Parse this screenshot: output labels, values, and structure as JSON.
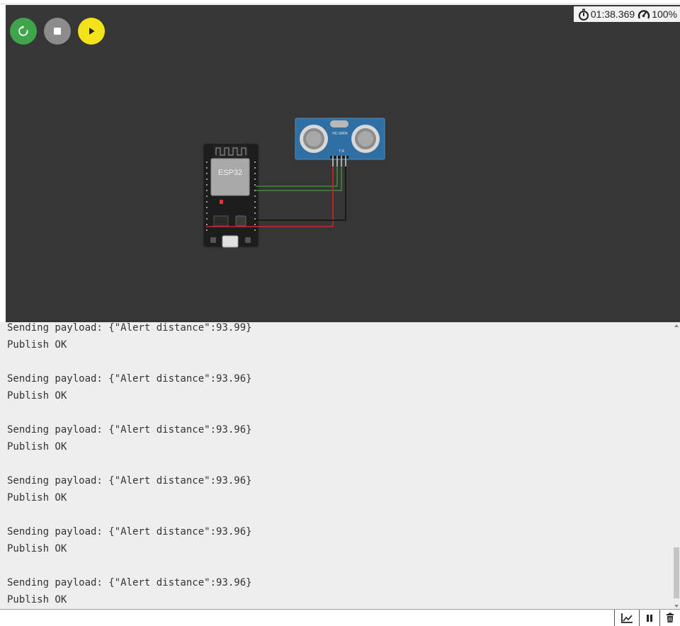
{
  "simulation": {
    "timer": "01:38.369",
    "speed": "100%",
    "controls": {
      "restart_icon": "restart-icon",
      "stop_icon": "stop-icon",
      "play_icon": "play-icon"
    },
    "board": {
      "chip_label": "ESP32"
    },
    "sensor": {
      "model_label": "HC-SR04"
    },
    "wire_colors": {
      "signal": "#3d8b36",
      "power": "#c62828",
      "ground": "#111111"
    }
  },
  "console": {
    "lines": [
      "Sending payload: {\"Alert distance\":93.99}",
      "Publish OK",
      "",
      "Sending payload: {\"Alert distance\":93.96}",
      "Publish OK",
      "",
      "Sending payload: {\"Alert distance\":93.96}",
      "Publish OK",
      "",
      "Sending payload: {\"Alert distance\":93.96}",
      "Publish OK",
      "",
      "Sending payload: {\"Alert distance\":93.96}",
      "Publish OK",
      "",
      "Sending payload: {\"Alert distance\":93.96}",
      "Publish OK"
    ]
  },
  "toolbar": {
    "buttons": [
      "chart-icon",
      "pause-icon",
      "trash-icon"
    ]
  }
}
